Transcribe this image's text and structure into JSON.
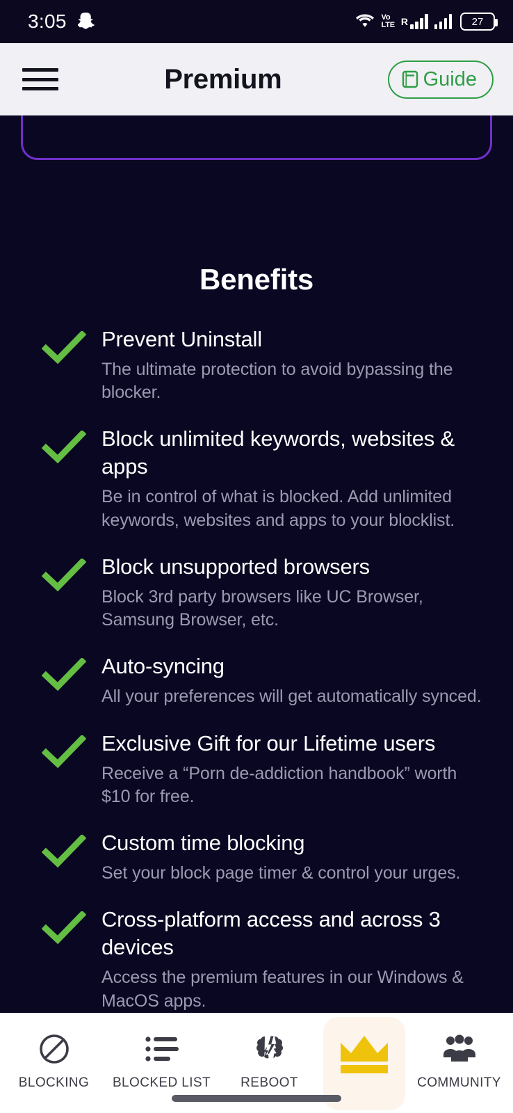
{
  "status_bar": {
    "time": "3:05",
    "app_notification_icon": "snapchat-ghost-icon",
    "wifi_icon": "wifi-icon",
    "volte_line1": "Vo",
    "volte_line2": "LTE",
    "roaming_label": "R",
    "battery_percent": "27"
  },
  "header": {
    "menu_icon": "hamburger-menu-icon",
    "title": "Premium",
    "guide_button_label": "Guide",
    "guide_icon": "book-icon",
    "accent_green": "#2f9e44",
    "background": "#f0f0f5"
  },
  "main": {
    "card_border_color": "#6f2fc8",
    "section_title": "Benefits",
    "check_color": "#63be43",
    "background": "#0a0722",
    "benefits": [
      {
        "title": "Prevent Uninstall",
        "desc": "The ultimate protection to avoid bypassing the blocker."
      },
      {
        "title": "Block unlimited keywords, websites & apps",
        "desc": "Be in control of what is blocked. Add unlimited keywords, websites and apps to your blocklist."
      },
      {
        "title": "Block unsupported browsers",
        "desc": "Block 3rd party browsers like UC Browser, Samsung Browser, etc."
      },
      {
        "title": "Auto-syncing",
        "desc": "All your preferences will get automatically synced."
      },
      {
        "title": "Exclusive Gift for our Lifetime users",
        "desc": "Receive a “Porn de-addiction handbook” worth $10 for free."
      },
      {
        "title": "Custom time blocking",
        "desc": "Set your block page timer & control your urges."
      },
      {
        "title": "Cross-platform access and across 3 devices",
        "desc": "Access the premium features in our Windows & MacOS apps."
      }
    ]
  },
  "bottom_nav": {
    "active_index": 3,
    "active_highlight": "#fdf4ec",
    "crown_color": "#efc30b",
    "items": [
      {
        "label": "BLOCKING",
        "icon": "prohibition-icon"
      },
      {
        "label": "BLOCKED LIST",
        "icon": "list-icon"
      },
      {
        "label": "REBOOT",
        "icon": "brain-bolt-icon"
      },
      {
        "label": "",
        "icon": "crown-icon"
      },
      {
        "label": "COMMUNITY",
        "icon": "people-group-icon"
      }
    ]
  }
}
